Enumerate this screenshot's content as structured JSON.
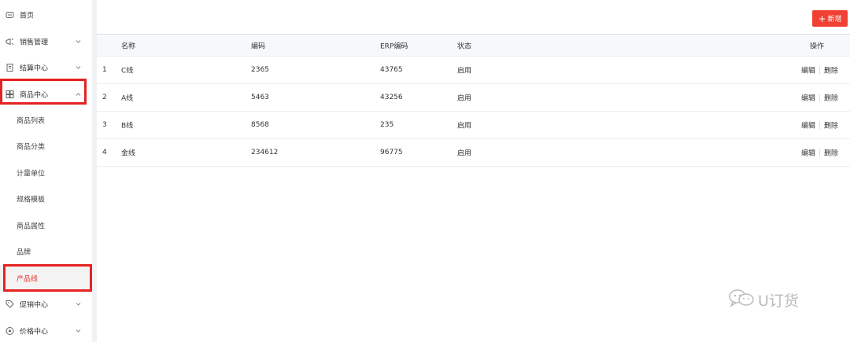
{
  "sidebar": {
    "items": [
      {
        "label": "首页",
        "icon": "home-icon"
      },
      {
        "label": "销售管理",
        "icon": "megaphone-icon"
      },
      {
        "label": "结算中心",
        "icon": "document-icon"
      },
      {
        "label": "商品中心",
        "icon": "grid-icon"
      },
      {
        "label": "促销中心",
        "icon": "tag-icon"
      },
      {
        "label": "价格中心",
        "icon": "price-icon"
      }
    ],
    "sub_items": [
      {
        "label": "商品列表"
      },
      {
        "label": "商品分类"
      },
      {
        "label": "计量单位"
      },
      {
        "label": "规格模板"
      },
      {
        "label": "商品属性"
      },
      {
        "label": "品牌"
      },
      {
        "label": "产品线"
      }
    ],
    "active_sub": "产品线",
    "highlight_color": "#e52222",
    "active_color": "#e8362b"
  },
  "toolbar": {
    "add_label": "新增",
    "add_color": "#f04134"
  },
  "table": {
    "headers": {
      "name": "名称",
      "code": "编码",
      "erp_code": "ERP编码",
      "status": "状态",
      "actions": "操作"
    },
    "rows": [
      {
        "index": "1",
        "name": "C线",
        "code": "2365",
        "erp": "43765",
        "status": "启用",
        "edit": "编辑",
        "delete": "删除"
      },
      {
        "index": "2",
        "name": "A线",
        "code": "5463",
        "erp": "43256",
        "status": "启用",
        "edit": "编辑",
        "delete": "删除"
      },
      {
        "index": "3",
        "name": "B线",
        "code": "8568",
        "erp": "235",
        "status": "启用",
        "edit": "编辑",
        "delete": "删除"
      },
      {
        "index": "4",
        "name": "金线",
        "code": "234612",
        "erp": "96775",
        "status": "启用",
        "edit": "编辑",
        "delete": "删除"
      }
    ]
  },
  "watermark": {
    "text": "U订货",
    "icon": "wechat-icon"
  }
}
